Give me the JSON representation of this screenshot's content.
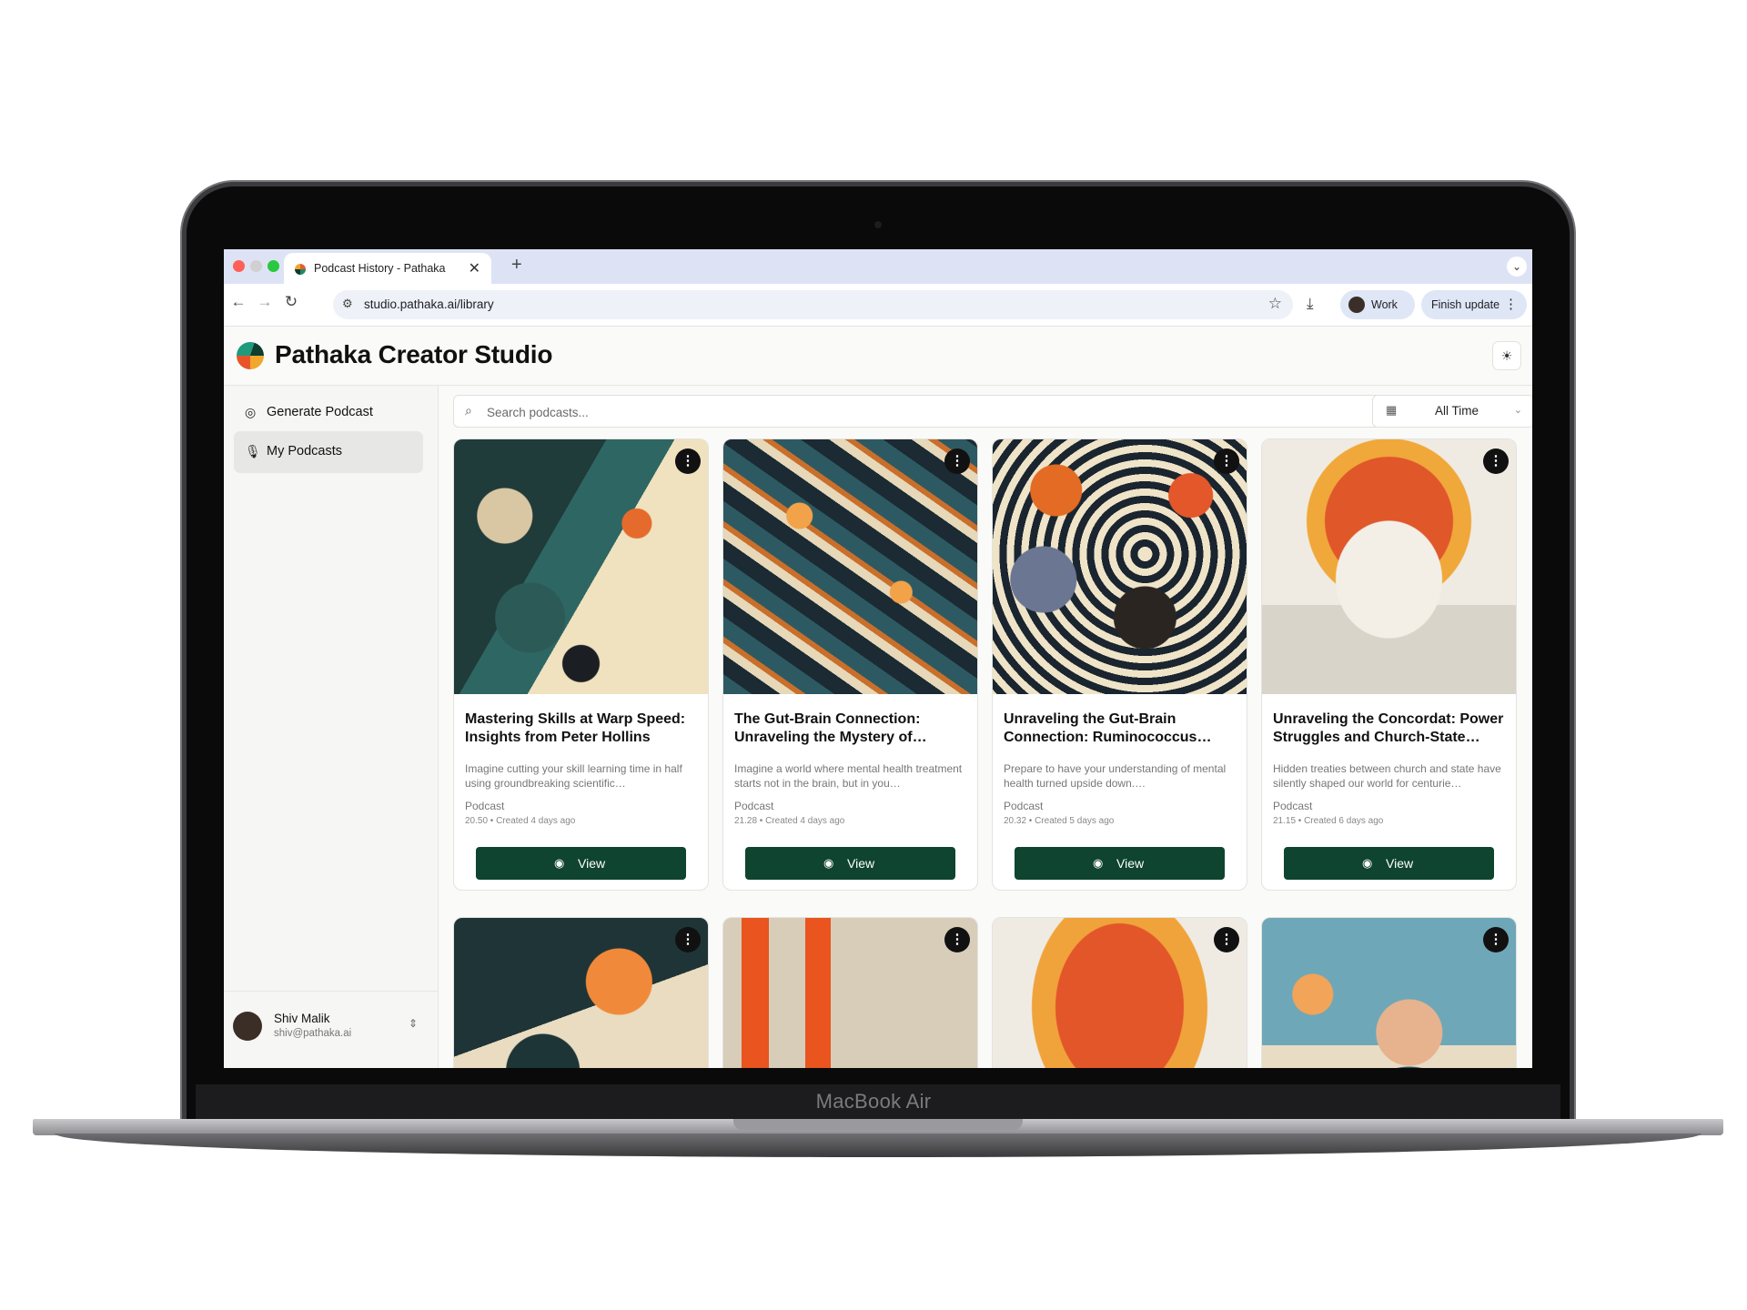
{
  "device": {
    "model_label": "MacBook Air"
  },
  "browser": {
    "tab_title": "Podcast History - Pathaka",
    "url": "studio.pathaka.ai/library",
    "profile_label": "Work",
    "update_label": "Finish update"
  },
  "app": {
    "title": "Pathaka Creator Studio",
    "sidebar": {
      "items": [
        {
          "label": "Generate Podcast",
          "icon": "podcast-icon"
        },
        {
          "label": "My Podcasts",
          "icon": "microphone-icon",
          "active": true
        }
      ],
      "user": {
        "name": "Shiv Malik",
        "email": "shiv@pathaka.ai"
      }
    },
    "search": {
      "placeholder": "Search podcasts..."
    },
    "filter": {
      "label": "All Time"
    },
    "view_label": "View",
    "cards": [
      {
        "title": "Mastering Skills at Warp Speed: Insights from Peter Hollins",
        "description": "Imagine cutting your skill learning time in half using groundbreaking scientific…",
        "type": "Podcast",
        "meta": "20.50 • Created 4 days ago"
      },
      {
        "title": "The Gut-Brain Connection: Unraveling the Mystery of…",
        "description": "Imagine a world where mental health treatment starts not in the brain, but in you…",
        "type": "Podcast",
        "meta": "21.28 • Created 4 days ago"
      },
      {
        "title": "Unraveling the Gut-Brain Connection: Ruminococcus…",
        "description": "Prepare to have your understanding of mental health turned upside down.…",
        "type": "Podcast",
        "meta": "20.32 • Created 5 days ago"
      },
      {
        "title": "Unraveling the Concordat: Power Struggles and Church-State…",
        "description": "Hidden treaties between church and state have silently shaped our world for centurie…",
        "type": "Podcast",
        "meta": "21.15 • Created 6 days ago"
      }
    ]
  },
  "colors": {
    "primary_button": "#0e4430",
    "tabstrip": "#dde3f5"
  }
}
